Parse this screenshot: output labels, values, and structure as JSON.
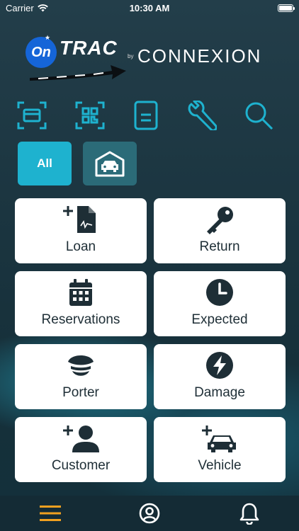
{
  "status_bar": {
    "carrier": "Carrier",
    "time": "10:30 AM"
  },
  "logo": {
    "on": "On",
    "trac": "TRAC",
    "by": "by",
    "connexion": "CONNEXION"
  },
  "toolbar": {
    "icons": [
      "card-scan-icon",
      "qr-scan-icon",
      "document-icon",
      "wrench-icon",
      "search-icon"
    ],
    "accent_color": "#1eb2cf"
  },
  "filters": {
    "all_label": "All",
    "garage_icon": "garage-car-icon",
    "active": "All"
  },
  "tiles": [
    {
      "label": "Loan",
      "icon": "add-document-icon"
    },
    {
      "label": "Return",
      "icon": "key-icon"
    },
    {
      "label": "Reservations",
      "icon": "calendar-icon"
    },
    {
      "label": "Expected",
      "icon": "clock-icon"
    },
    {
      "label": "Porter",
      "icon": "porter-cap-icon"
    },
    {
      "label": "Damage",
      "icon": "lightning-icon"
    },
    {
      "label": "Customer",
      "icon": "add-person-icon"
    },
    {
      "label": "Vehicle",
      "icon": "add-car-icon"
    }
  ],
  "bottom_nav": {
    "items": [
      "menu-icon",
      "account-icon",
      "bell-icon"
    ],
    "menu_color": "#f0a020"
  }
}
